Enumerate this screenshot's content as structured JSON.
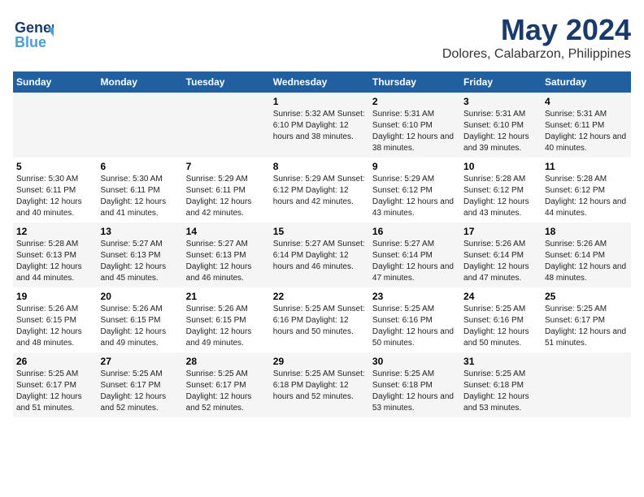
{
  "header": {
    "logo_line1": "General",
    "logo_line2": "Blue",
    "title": "May 2024",
    "subtitle": "Dolores, Calabarzon, Philippines"
  },
  "columns": [
    "Sunday",
    "Monday",
    "Tuesday",
    "Wednesday",
    "Thursday",
    "Friday",
    "Saturday"
  ],
  "weeks": [
    [
      {
        "day": "",
        "content": ""
      },
      {
        "day": "",
        "content": ""
      },
      {
        "day": "",
        "content": ""
      },
      {
        "day": "1",
        "content": "Sunrise: 5:32 AM\nSunset: 6:10 PM\nDaylight: 12 hours\nand 38 minutes."
      },
      {
        "day": "2",
        "content": "Sunrise: 5:31 AM\nSunset: 6:10 PM\nDaylight: 12 hours\nand 38 minutes."
      },
      {
        "day": "3",
        "content": "Sunrise: 5:31 AM\nSunset: 6:10 PM\nDaylight: 12 hours\nand 39 minutes."
      },
      {
        "day": "4",
        "content": "Sunrise: 5:31 AM\nSunset: 6:11 PM\nDaylight: 12 hours\nand 40 minutes."
      }
    ],
    [
      {
        "day": "5",
        "content": "Sunrise: 5:30 AM\nSunset: 6:11 PM\nDaylight: 12 hours\nand 40 minutes."
      },
      {
        "day": "6",
        "content": "Sunrise: 5:30 AM\nSunset: 6:11 PM\nDaylight: 12 hours\nand 41 minutes."
      },
      {
        "day": "7",
        "content": "Sunrise: 5:29 AM\nSunset: 6:11 PM\nDaylight: 12 hours\nand 42 minutes."
      },
      {
        "day": "8",
        "content": "Sunrise: 5:29 AM\nSunset: 6:12 PM\nDaylight: 12 hours\nand 42 minutes."
      },
      {
        "day": "9",
        "content": "Sunrise: 5:29 AM\nSunset: 6:12 PM\nDaylight: 12 hours\nand 43 minutes."
      },
      {
        "day": "10",
        "content": "Sunrise: 5:28 AM\nSunset: 6:12 PM\nDaylight: 12 hours\nand 43 minutes."
      },
      {
        "day": "11",
        "content": "Sunrise: 5:28 AM\nSunset: 6:12 PM\nDaylight: 12 hours\nand 44 minutes."
      }
    ],
    [
      {
        "day": "12",
        "content": "Sunrise: 5:28 AM\nSunset: 6:13 PM\nDaylight: 12 hours\nand 44 minutes."
      },
      {
        "day": "13",
        "content": "Sunrise: 5:27 AM\nSunset: 6:13 PM\nDaylight: 12 hours\nand 45 minutes."
      },
      {
        "day": "14",
        "content": "Sunrise: 5:27 AM\nSunset: 6:13 PM\nDaylight: 12 hours\nand 46 minutes."
      },
      {
        "day": "15",
        "content": "Sunrise: 5:27 AM\nSunset: 6:14 PM\nDaylight: 12 hours\nand 46 minutes."
      },
      {
        "day": "16",
        "content": "Sunrise: 5:27 AM\nSunset: 6:14 PM\nDaylight: 12 hours\nand 47 minutes."
      },
      {
        "day": "17",
        "content": "Sunrise: 5:26 AM\nSunset: 6:14 PM\nDaylight: 12 hours\nand 47 minutes."
      },
      {
        "day": "18",
        "content": "Sunrise: 5:26 AM\nSunset: 6:14 PM\nDaylight: 12 hours\nand 48 minutes."
      }
    ],
    [
      {
        "day": "19",
        "content": "Sunrise: 5:26 AM\nSunset: 6:15 PM\nDaylight: 12 hours\nand 48 minutes."
      },
      {
        "day": "20",
        "content": "Sunrise: 5:26 AM\nSunset: 6:15 PM\nDaylight: 12 hours\nand 49 minutes."
      },
      {
        "day": "21",
        "content": "Sunrise: 5:26 AM\nSunset: 6:15 PM\nDaylight: 12 hours\nand 49 minutes."
      },
      {
        "day": "22",
        "content": "Sunrise: 5:25 AM\nSunset: 6:16 PM\nDaylight: 12 hours\nand 50 minutes."
      },
      {
        "day": "23",
        "content": "Sunrise: 5:25 AM\nSunset: 6:16 PM\nDaylight: 12 hours\nand 50 minutes."
      },
      {
        "day": "24",
        "content": "Sunrise: 5:25 AM\nSunset: 6:16 PM\nDaylight: 12 hours\nand 50 minutes."
      },
      {
        "day": "25",
        "content": "Sunrise: 5:25 AM\nSunset: 6:17 PM\nDaylight: 12 hours\nand 51 minutes."
      }
    ],
    [
      {
        "day": "26",
        "content": "Sunrise: 5:25 AM\nSunset: 6:17 PM\nDaylight: 12 hours\nand 51 minutes."
      },
      {
        "day": "27",
        "content": "Sunrise: 5:25 AM\nSunset: 6:17 PM\nDaylight: 12 hours\nand 52 minutes."
      },
      {
        "day": "28",
        "content": "Sunrise: 5:25 AM\nSunset: 6:17 PM\nDaylight: 12 hours\nand 52 minutes."
      },
      {
        "day": "29",
        "content": "Sunrise: 5:25 AM\nSunset: 6:18 PM\nDaylight: 12 hours\nand 52 minutes."
      },
      {
        "day": "30",
        "content": "Sunrise: 5:25 AM\nSunset: 6:18 PM\nDaylight: 12 hours\nand 53 minutes."
      },
      {
        "day": "31",
        "content": "Sunrise: 5:25 AM\nSunset: 6:18 PM\nDaylight: 12 hours\nand 53 minutes."
      },
      {
        "day": "",
        "content": ""
      }
    ]
  ]
}
